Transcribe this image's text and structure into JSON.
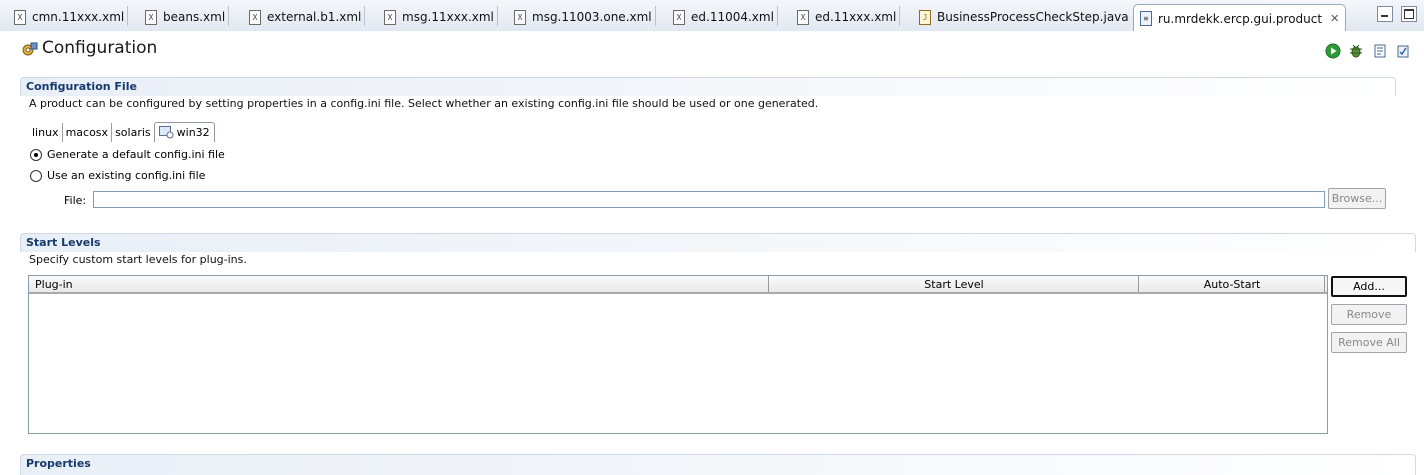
{
  "tabs": [
    {
      "label": "cmn.11xxx.xml",
      "icon": "xml-file-icon"
    },
    {
      "label": "beans.xml",
      "icon": "xml-file-icon"
    },
    {
      "label": "external.b1.xml",
      "icon": "xml-file-icon"
    },
    {
      "label": "msg.11xxx.xml",
      "icon": "xml-file-icon"
    },
    {
      "label": "msg.11003.one.xml",
      "icon": "xml-file-icon"
    },
    {
      "label": "ed.11004.xml",
      "icon": "xml-file-icon"
    },
    {
      "label": "ed.11xxx.xml",
      "icon": "xml-file-icon"
    },
    {
      "label": "BusinessProcessCheckStep.java",
      "icon": "java-file-icon"
    },
    {
      "label": "ru.mrdekk.ercp.gui.product",
      "icon": "product-file-icon"
    }
  ],
  "page": {
    "title": "Configuration"
  },
  "config_file": {
    "title": "Configuration File",
    "description": "A product can be configured by setting properties in a config.ini file.  Select whether an existing config.ini file should be used or one generated.",
    "os_tabs": [
      "linux",
      "macosx",
      "solaris",
      "win32"
    ],
    "selected_os": "win32",
    "options": [
      {
        "label": "Generate a default config.ini file",
        "selected": true
      },
      {
        "label": "Use an existing config.ini file",
        "selected": false
      }
    ],
    "file_label": "File:",
    "file_value": "",
    "browse_label": "Browse..."
  },
  "start_levels": {
    "title": "Start Levels",
    "description": "Specify custom start levels for plug-ins.",
    "columns": [
      "Plug-in",
      "Start Level",
      "Auto-Start"
    ],
    "rows": [],
    "add_label": "Add...",
    "remove_label": "Remove",
    "remove_all_label": "Remove All"
  },
  "properties": {
    "title": "Properties"
  }
}
